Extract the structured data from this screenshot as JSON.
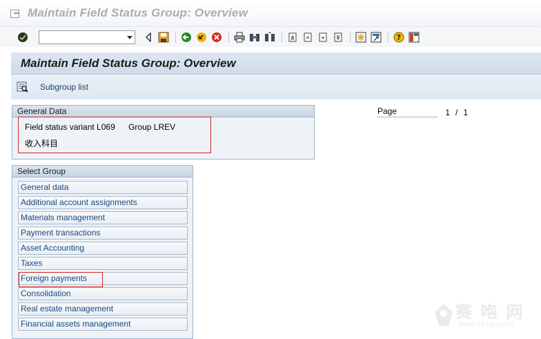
{
  "window": {
    "title": "Maintain Field Status Group: Overview"
  },
  "toolbar": {
    "command_field_value": "",
    "buttons": [
      "enter-icon",
      "back-icon",
      "save-icon",
      "back-green-icon",
      "exit-icon",
      "cancel-icon",
      "print-icon",
      "find-icon",
      "find-next-icon",
      "first-page-icon",
      "prev-page-icon",
      "next-page-icon",
      "last-page-icon",
      "create-session-icon",
      "shortcut-icon",
      "help-icon",
      "layout-icon"
    ]
  },
  "header": {
    "title": "Maintain Field Status Group: Overview"
  },
  "app_toolbar": {
    "subgroup_list_label": "Subgroup list",
    "icon": "subgroup-list-icon"
  },
  "general_data": {
    "frame_title": "General Data",
    "field_status_variant": "Field status variant L069",
    "group": "Group LREV",
    "description": "收入科目"
  },
  "paging": {
    "label": "Page",
    "current": "1",
    "separator": "/",
    "total": "1"
  },
  "select_group": {
    "frame_title": "Select Group",
    "items": [
      "General data",
      "Additional account assignments",
      "Materials management",
      "Payment transactions",
      "Asset Accounting",
      "Taxes",
      "Foreign payments",
      "Consolidation",
      "Real estate management",
      "Financial assets management"
    ]
  },
  "watermark": {
    "big_text": "赛 咆 网",
    "small_text": "www.91sap.com"
  },
  "colors": {
    "highlight_border": "#d62020",
    "link_text": "#174a80",
    "header_band": "#cfdbe8"
  }
}
